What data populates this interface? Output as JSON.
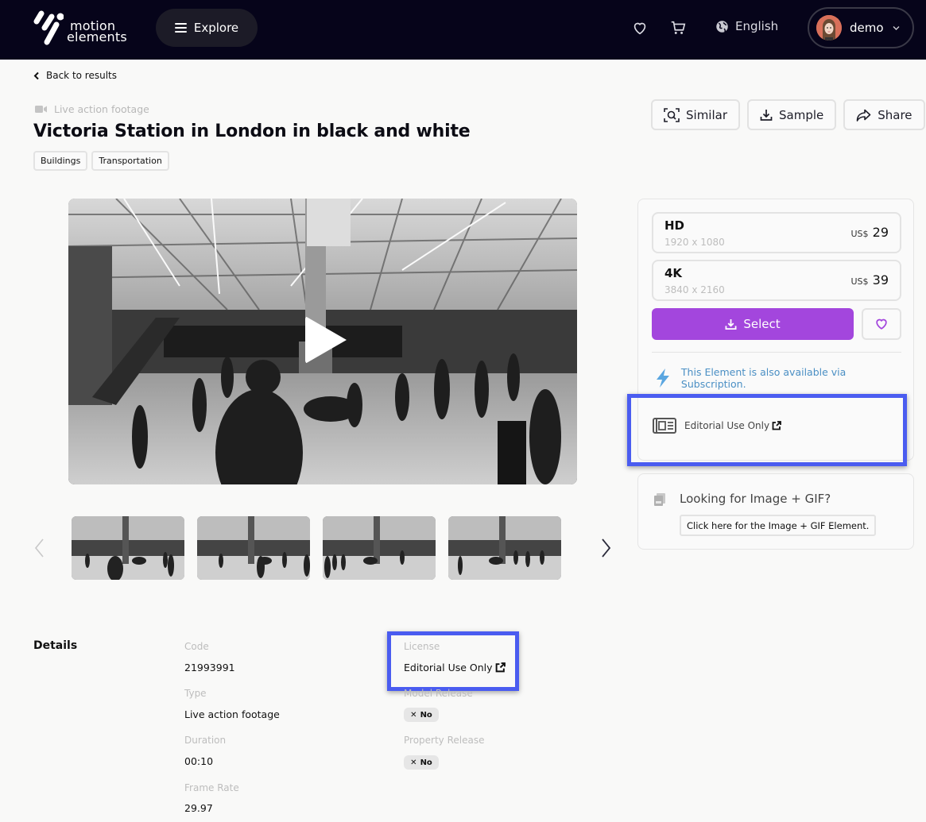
{
  "header": {
    "logo_line1": "motion",
    "logo_line2": "elements",
    "explore_label": "Explore",
    "language": "English",
    "username": "demo",
    "icons": [
      "heart-icon",
      "cart-icon",
      "globe-icon",
      "chevron-down-icon"
    ]
  },
  "breadcrumb": {
    "back_label": "Back to results"
  },
  "element": {
    "type": "Live action footage",
    "title": "Victoria Station in London in black and white",
    "tags": [
      "Buildings",
      "Transportation"
    ]
  },
  "actions": {
    "similar": "Similar",
    "sample": "Sample",
    "share": "Share"
  },
  "thumbnails_count": 4,
  "pricing": {
    "options": [
      {
        "name": "HD",
        "resolution": "1920 x 1080",
        "currency": "US$",
        "price": "29"
      },
      {
        "name": "4K",
        "resolution": "3840 x 2160",
        "currency": "US$",
        "price": "39"
      }
    ],
    "select_label": "Select",
    "subscription_text": "This Element is also available via Subscription.",
    "license_text": "Editorial Use Only",
    "accent_color": "#a346dd",
    "subscription_color": "#4a8fc4"
  },
  "gif_panel": {
    "title": "Looking for Image + GIF?",
    "button": "Click here for the Image + GIF Element."
  },
  "details": {
    "heading": "Details",
    "code_label": "Code",
    "code": "21993991",
    "type_label": "Type",
    "type": "Live action footage",
    "duration_label": "Duration",
    "duration": "00:10",
    "frame_rate_label": "Frame Rate",
    "frame_rate": "29.97",
    "license_label": "License",
    "license": "Editorial Use Only",
    "model_release_label": "Model Release",
    "model_release": "No",
    "property_release_label": "Property Release",
    "property_release": "No"
  },
  "highlight_color": "#4a5cf0"
}
